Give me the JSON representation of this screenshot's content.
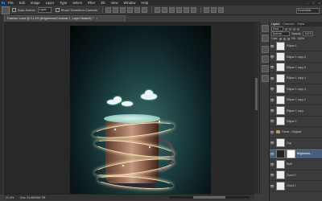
{
  "app": {
    "logo": "Ps"
  },
  "menu": [
    "File",
    "Edit",
    "Image",
    "Layer",
    "Type",
    "Select",
    "Filter",
    "3D",
    "View",
    "Window",
    "Help"
  ],
  "window_controls": [
    "–",
    "□",
    "×"
  ],
  "options": {
    "auto_select": "Auto-Select:",
    "auto_select_target": "Layer",
    "show_transform": "Show Transform Controls",
    "workspace": "Essentials"
  },
  "document": {
    "tab_title": "Fashion Land @ 21.4% (Brightness/Contrast 1, Layer Mask/8) *",
    "close": "×"
  },
  "status": {
    "zoom": "21.4%",
    "doc_info": "Doc: 24.8M/260.7M"
  },
  "layers_panel": {
    "tabs": [
      "Layers",
      "Channels",
      "Paths"
    ],
    "filter_label": "Kind",
    "blend_mode": "Normal",
    "opacity_label": "Opacity:",
    "opacity": "100%",
    "lock_label": "Lock:",
    "fill_label": "Fill:",
    "fill": "100%",
    "layers": [
      {
        "name": "Ellipse 1",
        "kind": "transparent",
        "selected": false
      },
      {
        "name": "Ellipse 1 copy 6",
        "kind": "transparent",
        "selected": false
      },
      {
        "name": "Ellipse 1 copy 5",
        "kind": "transparent",
        "selected": false
      },
      {
        "name": "Ellipse 1 copy 4",
        "kind": "transparent",
        "selected": false
      },
      {
        "name": "Ellipse 1 copy 3",
        "kind": "transparent",
        "selected": false
      },
      {
        "name": "Ellipse 1 copy 2",
        "kind": "transparent",
        "selected": false
      },
      {
        "name": "Ellipse 1 copy",
        "kind": "transparent",
        "selected": false
      },
      {
        "name": "Ellipse 1",
        "kind": "transparent",
        "selected": false
      },
      {
        "name": "Flame - Original",
        "kind": "group",
        "selected": false
      },
      {
        "name": "Cup",
        "kind": "transparent",
        "selected": false
      },
      {
        "name": "Brightness...",
        "kind": "adjustment",
        "selected": true
      },
      {
        "name": "Bulb",
        "kind": "transparent",
        "selected": false
      },
      {
        "name": "Cloud 2",
        "kind": "transparent",
        "selected": false
      },
      {
        "name": "Cloud 1",
        "kind": "transparent",
        "selected": false
      }
    ]
  }
}
